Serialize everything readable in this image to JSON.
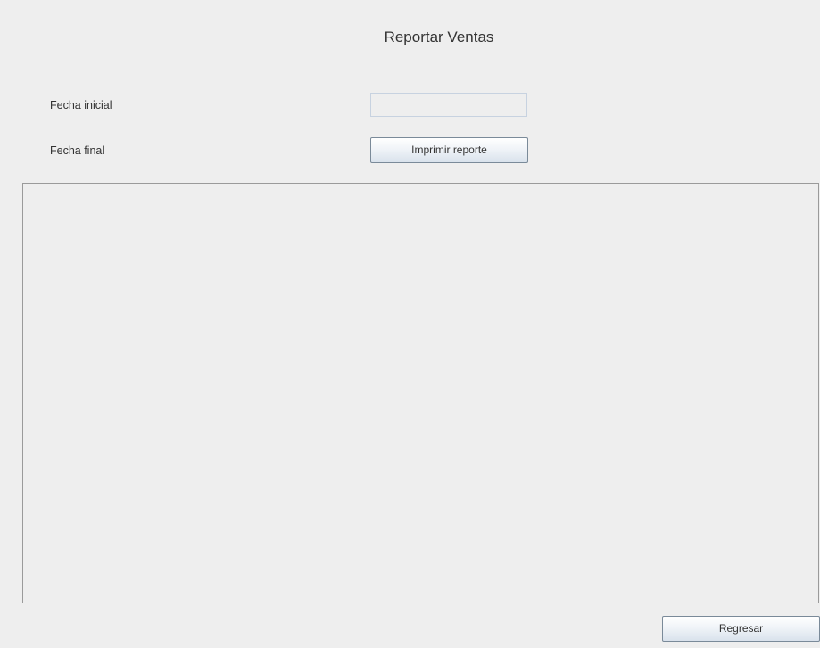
{
  "form": {
    "title": "Reportar Ventas",
    "start_date_label": "Fecha inicial",
    "start_date_value": "",
    "end_date_label": "Fecha final",
    "print_button_label": "Imprimir reporte",
    "back_button_label": "Regresar"
  }
}
